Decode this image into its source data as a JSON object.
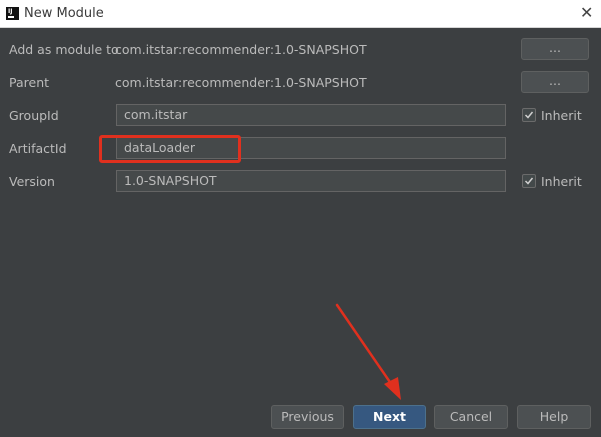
{
  "window": {
    "title": "New Module"
  },
  "form": {
    "add_as_module_label": "Add as module to",
    "add_as_module_value": "com.itstar:recommender:1.0-SNAPSHOT",
    "parent_label": "Parent",
    "parent_value": "com.itstar:recommender:1.0-SNAPSHOT",
    "groupid_label": "GroupId",
    "groupid_value": "com.itstar",
    "artifactid_label": "ArtifactId",
    "artifactid_value": "dataLoader",
    "version_label": "Version",
    "version_value": "1.0-SNAPSHOT",
    "browse_label": "...",
    "inherit_label": "Inherit",
    "groupid_inherit_checked": true,
    "version_inherit_checked": true
  },
  "buttons": {
    "previous": "Previous",
    "next": "Next",
    "cancel": "Cancel",
    "help": "Help"
  },
  "colors": {
    "background": "#3c3f41",
    "primary_button": "#365880",
    "annotation_red": "#e0301e"
  },
  "icons": {
    "app": "intellij-icon",
    "close": "close-icon",
    "check": "checkmark-icon"
  }
}
